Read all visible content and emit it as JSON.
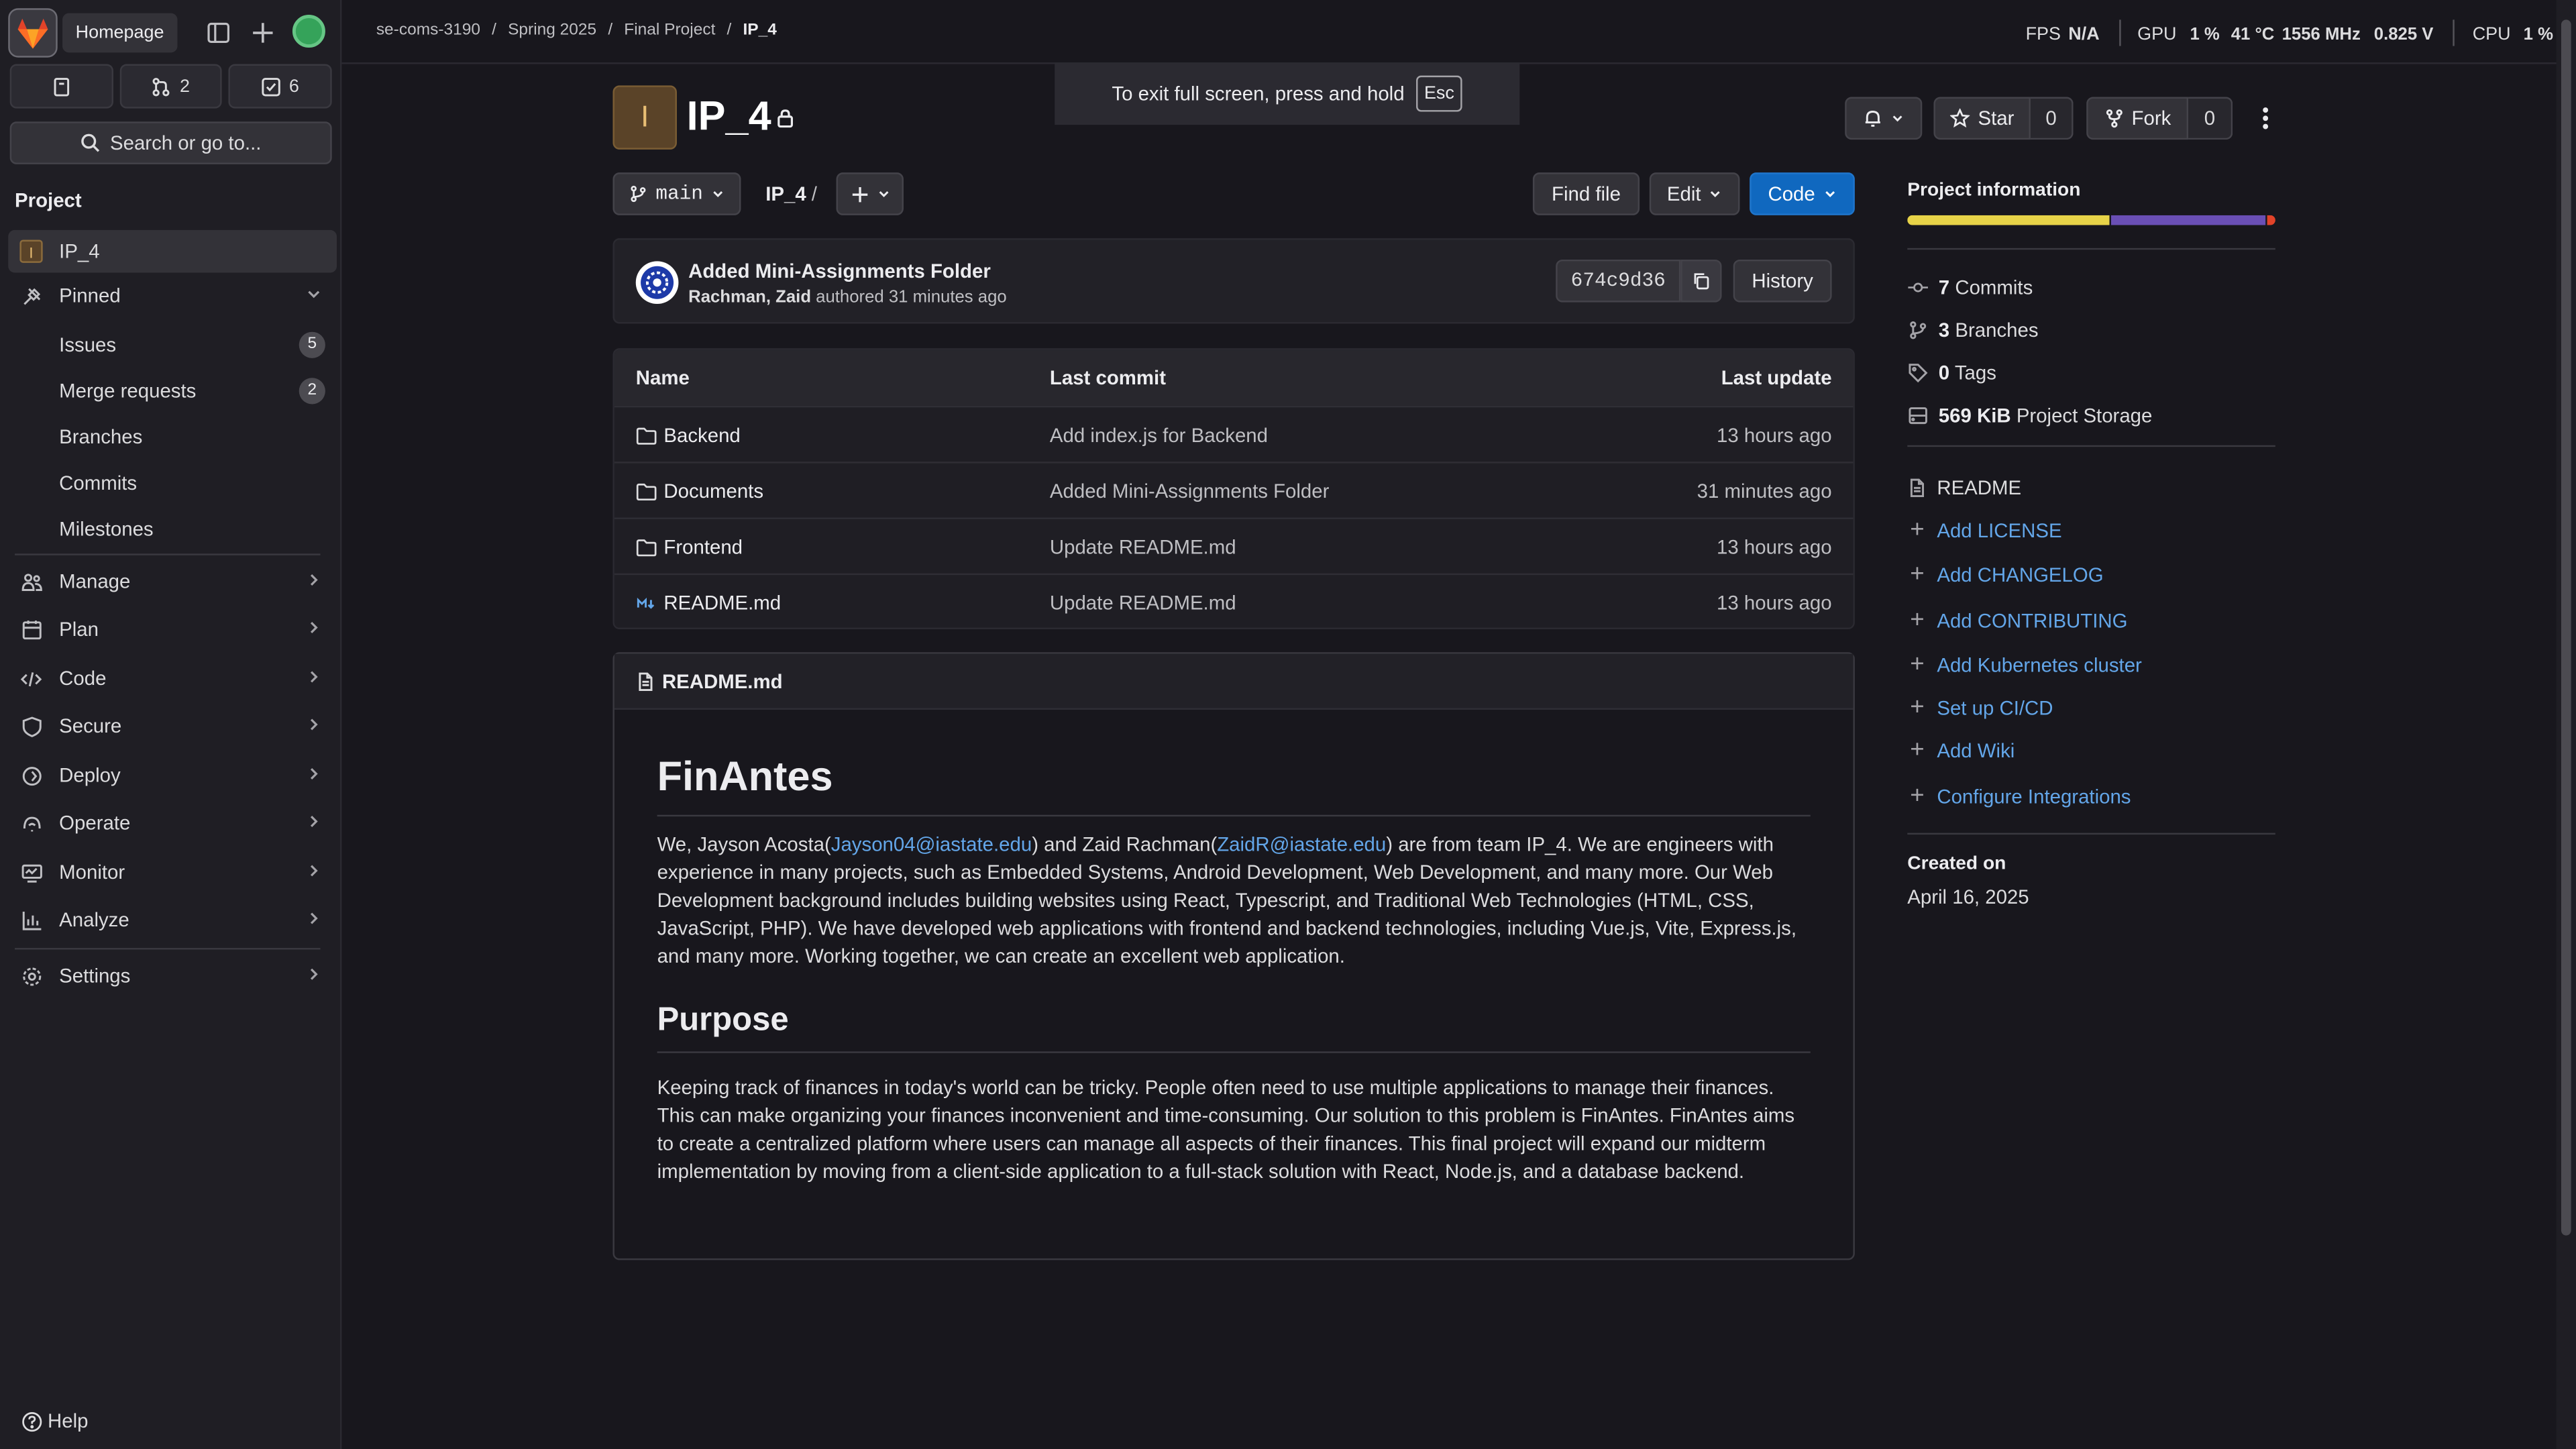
{
  "sidebar": {
    "homepage_tooltip": "Homepage",
    "counters": {
      "merge_requests": "2",
      "todos": "6"
    },
    "search_placeholder": "Search or go to...",
    "section_title": "Project",
    "project_name": "IP_4",
    "project_initial": "I",
    "pinned_label": "Pinned",
    "pinned_items": [
      {
        "label": "Issues",
        "count": "5"
      },
      {
        "label": "Merge requests",
        "count": "2"
      },
      {
        "label": "Branches"
      },
      {
        "label": "Commits"
      },
      {
        "label": "Milestones"
      }
    ],
    "menu": [
      "Manage",
      "Plan",
      "Code",
      "Secure",
      "Deploy",
      "Operate",
      "Monitor",
      "Analyze"
    ],
    "settings_label": "Settings",
    "help_label": "Help"
  },
  "breadcrumb": [
    "se-coms-3190",
    "Spring 2025",
    "Final Project",
    "IP_4"
  ],
  "perf": {
    "fps_label": "FPS",
    "fps_value": "N/A",
    "gpu_label": "GPU",
    "gpu_usage": "1 %",
    "gpu_temp": "41 °C",
    "gpu_clock": "1556 MHz",
    "gpu_volt": "0.825 V",
    "cpu_label": "CPU",
    "cpu_usage": "1 %"
  },
  "fullscreen": {
    "text": "To exit full screen, press and hold",
    "key": "Esc"
  },
  "project": {
    "initial": "I",
    "title": "IP_4",
    "star_label": "Star",
    "star_count": "0",
    "fork_label": "Fork",
    "fork_count": "0"
  },
  "repo_nav": {
    "branch": "main",
    "path": "IP_4",
    "path_sep": "/",
    "find_file": "Find file",
    "edit": "Edit",
    "code": "Code"
  },
  "last_commit": {
    "message": "Added Mini-Assignments Folder",
    "author": "Rachman, Zaid",
    "authored_text": "authored 31 minutes ago",
    "sha": "674c9d36",
    "history": "History"
  },
  "files_table": {
    "columns": [
      "Name",
      "Last commit",
      "Last update"
    ],
    "rows": [
      {
        "name": "Backend",
        "commit": "Add index.js for Backend",
        "updated": "13 hours ago",
        "type": "folder"
      },
      {
        "name": "Documents",
        "commit": "Added Mini-Assignments Folder",
        "updated": "31 minutes ago",
        "type": "folder"
      },
      {
        "name": "Frontend",
        "commit": "Update README.md",
        "updated": "13 hours ago",
        "type": "folder"
      },
      {
        "name": "README.md",
        "commit": "Update README.md",
        "updated": "13 hours ago",
        "type": "markdown"
      }
    ]
  },
  "readme": {
    "filename": "README.md",
    "h1": "FinAntes",
    "p1_a": "We, Jayson Acosta(",
    "p1_link1": "Jayson04@iastate.edu",
    "p1_b": ") and Zaid Rachman(",
    "p1_link2": "ZaidR@iastate.edu",
    "p1_c": ") are from team IP_4. We are engineers with experience in many projects, such as Embedded Systems, Android Development, Web Development, and many more. Our Web Development background includes building websites using React, Typescript, and Traditional Web Technologies (HTML, CSS, JavaScript, PHP). We have developed web applications with frontend and backend technologies, including Vue.js, Vite, Express.js, and many more. Working together, we can create an excellent web application.",
    "h2": "Purpose",
    "p2": "Keeping track of finances in today's world can be tricky. People often need to use multiple applications to manage their finances. This can make organizing your finances inconvenient and time-consuming. Our solution to this problem is FinAntes. FinAntes aims to create a centralized platform where users can manage all aspects of their finances. This final project will expand our midterm implementation by moving from a client-side application to a full-stack solution with React, Node.js, and a database backend."
  },
  "project_info": {
    "title": "Project information",
    "language_bar": [
      {
        "color": "#e7d348",
        "share": 0.55
      },
      {
        "color": "#6a4fb5",
        "share": 0.42
      },
      {
        "color": "#e24329",
        "share": 0.03
      }
    ],
    "stats": [
      {
        "value": "7",
        "label": "Commits"
      },
      {
        "value": "3",
        "label": "Branches"
      },
      {
        "value": "0",
        "label": "Tags"
      },
      {
        "value": "569 KiB",
        "label": "Project Storage"
      }
    ],
    "readme_label": "README",
    "add_links": [
      "Add LICENSE",
      "Add CHANGELOG",
      "Add CONTRIBUTING",
      "Add Kubernetes cluster",
      "Set up CI/CD",
      "Add Wiki",
      "Configure Integrations"
    ],
    "created_label": "Created on",
    "created_date": "April 16, 2025"
  }
}
